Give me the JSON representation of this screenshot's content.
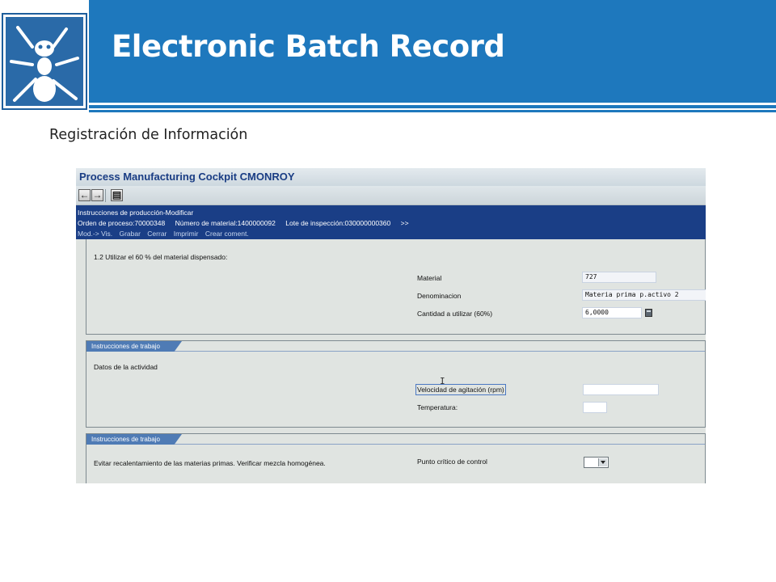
{
  "slide": {
    "title": "Electronic Batch Record",
    "subtitle": "Registración de Información",
    "logo_icon": "ant-logo-icon",
    "header_color": "#1e78bd"
  },
  "sap": {
    "window_title": "Process Manufacturing Cockpit CMONROY",
    "toolbar": {
      "back_icon": "arrow-left-icon",
      "forward_icon": "arrow-right-icon",
      "save_icon": "save-layout-icon"
    },
    "header": {
      "heading": "Instrucciones de producción-Modificar",
      "process_order": "Orden de proceso:70000348",
      "material_number": "Número de material:1400000092",
      "inspection_lot": "Lote de inspección:030000000360",
      "more": ">>"
    },
    "menu": [
      "Mod.-> Vis.",
      "Grabar",
      "Cerrar",
      "Imprimir",
      "Crear coment."
    ],
    "section1": {
      "instruction": "1.2 Utilizar el 60 % del material dispensado:",
      "fields": [
        {
          "label": "Material",
          "value": "727"
        },
        {
          "label": "Denominacion",
          "value": "Materia prima p.activo 2"
        },
        {
          "label": "Cantidad a utilizar (60%)",
          "value": "6,0000"
        }
      ]
    },
    "section2": {
      "tab": "Instrucciones de trabajo",
      "text": "Datos de la actividad",
      "fields": [
        {
          "label": "Velocidad de agitación (rpm)",
          "value": ""
        },
        {
          "label": "Temperatura:",
          "value": ""
        }
      ]
    },
    "section3": {
      "tab": "Instrucciones de trabajo",
      "text": "Evitar recalentamiento de las materias primas. Verificar mezcla homogénea.",
      "field_label": "Punto crítico de control",
      "field_value": ""
    }
  }
}
